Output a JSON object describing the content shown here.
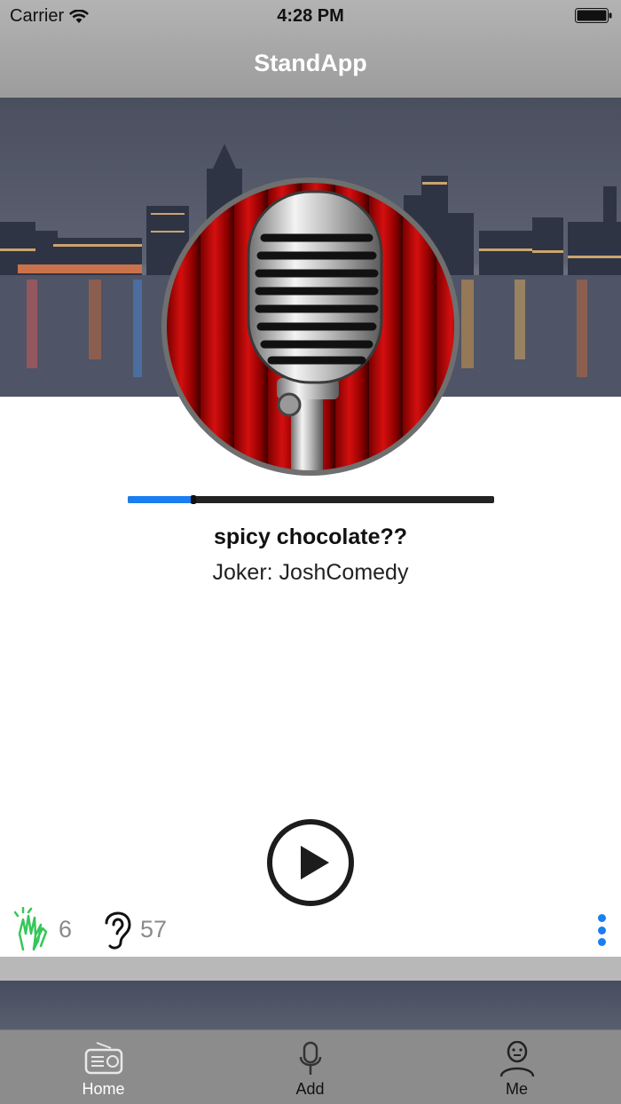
{
  "status_bar": {
    "carrier": "Carrier",
    "time": "4:28 PM"
  },
  "nav": {
    "title": "StandApp"
  },
  "player": {
    "joke_title": "spicy chocolate??",
    "joke_author": "Joker: JoshComedy",
    "progress_fraction": 0.18,
    "play_icon": "play-circle-icon"
  },
  "stats": {
    "claps": "6",
    "listens": "57",
    "clap_icon": "clapping-hands-icon",
    "listen_icon": "ear-icon",
    "more_icon": "more-vertical-icon"
  },
  "tabbar": {
    "tabs": [
      {
        "label": "Home",
        "icon": "radio-icon",
        "active": true
      },
      {
        "label": "Add",
        "icon": "microphone-icon",
        "active": false
      },
      {
        "label": "Me",
        "icon": "user-icon",
        "active": false
      }
    ]
  },
  "colors": {
    "accent": "#1a7ef0",
    "clap_green": "#34c759",
    "topbar": "#a6a6a6",
    "tabbar": "#8c8c8c"
  }
}
